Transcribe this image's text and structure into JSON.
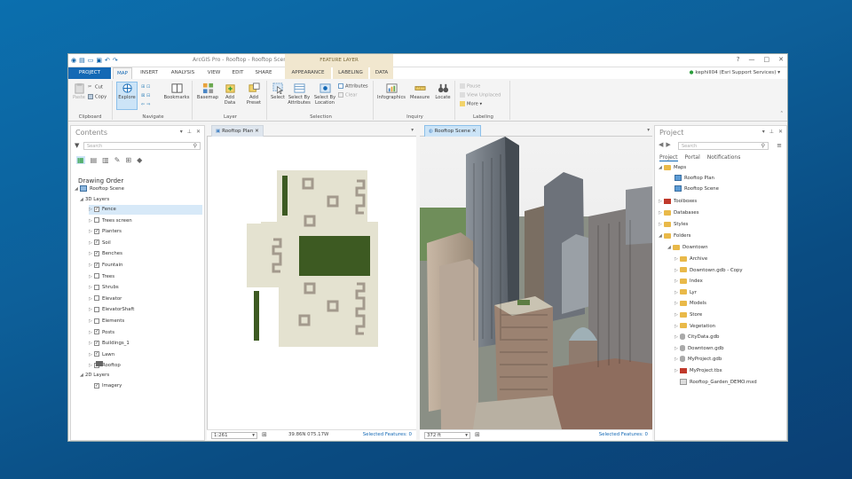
{
  "titlebar": {
    "title": "ArcGIS Pro - Rooftop - Rooftop Scene",
    "context_tab_title": "FEATURE LAYER",
    "help": "?",
    "minimize": "—",
    "maximize": "□",
    "close": "✕"
  },
  "tabs": [
    {
      "label": "PROJECT"
    },
    {
      "label": "MAP"
    },
    {
      "label": "INSERT"
    },
    {
      "label": "ANALYSIS"
    },
    {
      "label": "VIEW"
    },
    {
      "label": "EDIT"
    },
    {
      "label": "SHARE"
    },
    {
      "label": "APPEARANCE"
    },
    {
      "label": "LABELING"
    },
    {
      "label": "DATA"
    }
  ],
  "user": {
    "name": "kephill04 (Esri Support Services)"
  },
  "ribbon": {
    "clipboard": {
      "label": "Clipboard",
      "paste": "Paste",
      "cut": "Cut",
      "copy": "Copy"
    },
    "navigate": {
      "label": "Navigate",
      "explore": "Explore",
      "bookmarks": "Bookmarks"
    },
    "layer": {
      "label": "Layer",
      "basemap": "Basemap",
      "add_data": "Add Data",
      "add_preset": "Add Preset"
    },
    "selection": {
      "label": "Selection",
      "select": "Select",
      "select_by_attributes": "Select By Attributes",
      "select_by_location": "Select By Location",
      "attributes": "Attributes",
      "clear": "Clear"
    },
    "inquiry": {
      "label": "Inquiry",
      "infographics": "Infographics",
      "measure": "Measure",
      "locate": "Locate"
    },
    "labeling": {
      "label": "Labeling",
      "pause": "Pause",
      "view_unplaced": "View Unplaced",
      "more": "More"
    }
  },
  "contents": {
    "title": "Contents",
    "search_placeholder": "Search",
    "drawing_order": "Drawing Order",
    "scene": "Rooftop Scene",
    "group_3d": "3D Layers",
    "group_2d": "2D Layers",
    "layers_3d": [
      {
        "name": "Fence",
        "checked": true,
        "selected": true
      },
      {
        "name": "Trees screen",
        "checked": false
      },
      {
        "name": "Planters",
        "checked": true
      },
      {
        "name": "Soil",
        "checked": true
      },
      {
        "name": "Benches",
        "checked": true
      },
      {
        "name": "Fountain",
        "checked": true
      },
      {
        "name": "Trees",
        "checked": false
      },
      {
        "name": "Shrubs",
        "checked": false
      },
      {
        "name": "Elevator",
        "checked": false
      },
      {
        "name": "ElevatorShaft",
        "checked": false
      },
      {
        "name": "Elements",
        "checked": false
      },
      {
        "name": "Posts",
        "checked": true
      },
      {
        "name": "Buildings_1",
        "checked": true
      },
      {
        "name": "Lawn",
        "checked": true
      },
      {
        "name": "Rooftop",
        "checked": true
      }
    ],
    "layers_2d": [
      {
        "name": "Imagery",
        "checked": true
      }
    ]
  },
  "views": {
    "plan": {
      "tab": "Rooftop Plan",
      "scale": "1:261",
      "coords": "39.86N 075.17W",
      "selected": "Selected Features: 0"
    },
    "scene": {
      "tab": "Rooftop Scene",
      "scale": "372 ft",
      "selected": "Selected Features: 0"
    }
  },
  "project": {
    "title": "Project",
    "search_placeholder": "Search",
    "subtabs": [
      "Project",
      "Portal",
      "Notifications"
    ],
    "maps_label": "Maps",
    "maps": [
      "Rooftop Plan",
      "Rooftop Scene"
    ],
    "toolboxes": "Toolboxes",
    "databases": "Databases",
    "styles": "Styles",
    "folders": "Folders",
    "downtown": "Downtown",
    "downtown_items": [
      {
        "name": "Archive",
        "kind": "folder"
      },
      {
        "name": "Downtown.gdb - Copy",
        "kind": "folder"
      },
      {
        "name": "Index",
        "kind": "folder"
      },
      {
        "name": "Lyr",
        "kind": "folder"
      },
      {
        "name": "Models",
        "kind": "folder"
      },
      {
        "name": "Store",
        "kind": "folder"
      },
      {
        "name": "Vegetation",
        "kind": "folder"
      },
      {
        "name": "CityData.gdb",
        "kind": "gdb"
      },
      {
        "name": "Downtown.gdb",
        "kind": "gdb"
      },
      {
        "name": "MyProject.gdb",
        "kind": "gdb"
      },
      {
        "name": "MyProject.tbx",
        "kind": "tbx"
      },
      {
        "name": "Rooftop_Garden_DEMO.mxd",
        "kind": "mxd"
      }
    ]
  },
  "colors": {
    "accent": "#1469b5",
    "context_tab": "#f1e7cf",
    "lawn": "#3d5a22",
    "roof": "#e4e2d0"
  }
}
